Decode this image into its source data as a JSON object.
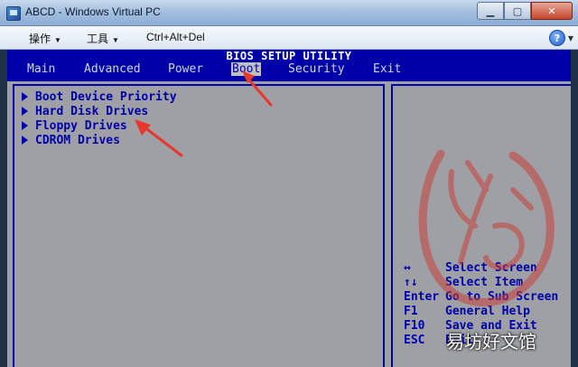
{
  "window": {
    "title": "ABCD - Windows Virtual PC",
    "minimize_glyph": "▁",
    "maximize_glyph": "▢",
    "close_glyph": "✕"
  },
  "menubar": {
    "items": [
      {
        "label": "操作"
      },
      {
        "label": "工具"
      },
      {
        "label": "Ctrl+Alt+Del"
      }
    ],
    "help_glyph": "?"
  },
  "bios": {
    "title": "BIOS SETUP UTILITY",
    "tabs": [
      "Main",
      "Advanced",
      "Power",
      "Boot",
      "Security",
      "Exit"
    ],
    "active_tab": "Boot",
    "items": [
      "Boot Device Priority",
      "Hard Disk Drives",
      "Floppy Drives",
      "CDROM Drives"
    ],
    "help_keys": [
      {
        "key": "↔",
        "action": "Select Screen"
      },
      {
        "key": "↑↓",
        "action": "Select Item"
      },
      {
        "key": "Enter",
        "action": "Go to Sub Screen"
      },
      {
        "key": "F1",
        "action": "General Help"
      },
      {
        "key": "F10",
        "action": "Save and Exit"
      },
      {
        "key": "ESC",
        "action": "Exit"
      }
    ]
  },
  "watermark": {
    "text": "易坊好文馆"
  },
  "colors": {
    "bios_blue": "#0000a8",
    "bios_gray": "#9fa0a5",
    "arrow_red": "#e8372c"
  }
}
